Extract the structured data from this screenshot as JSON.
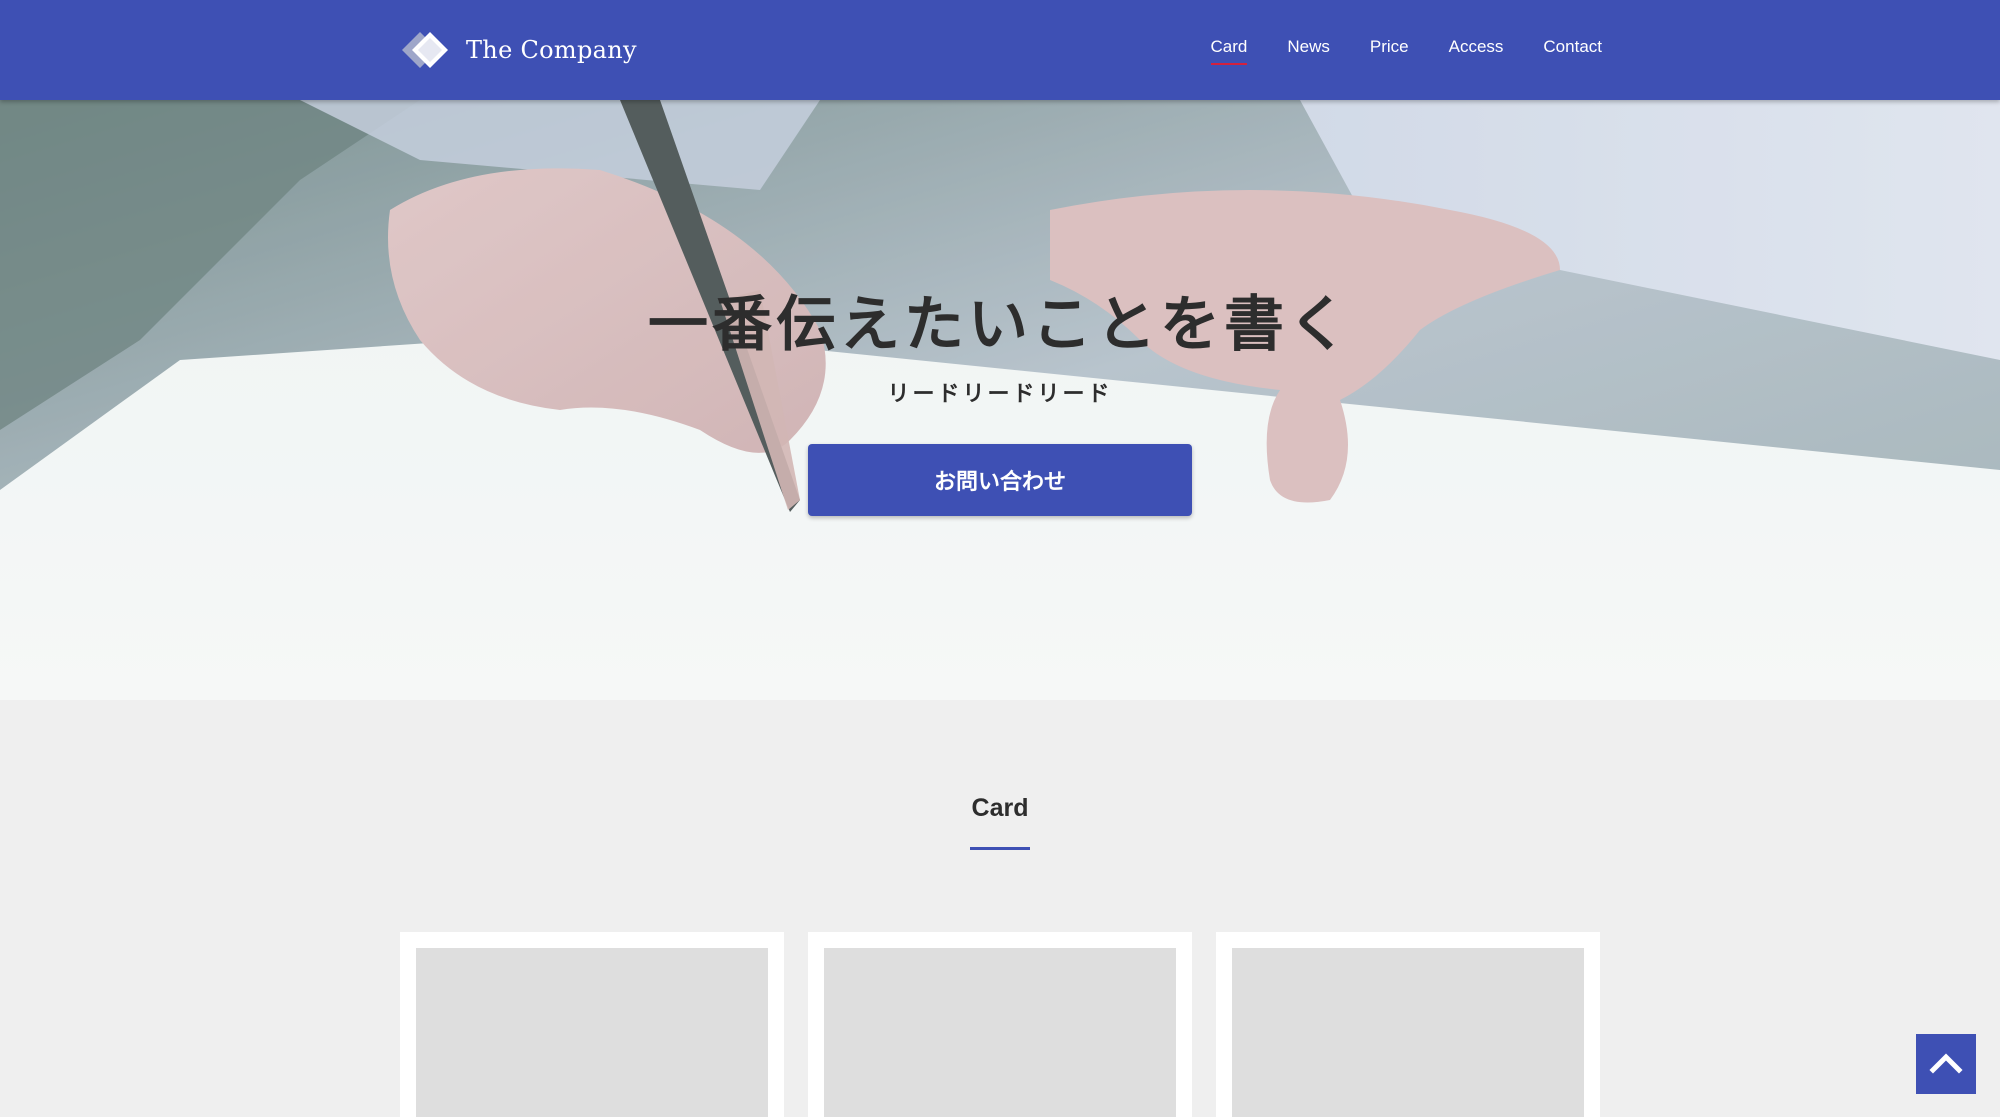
{
  "header": {
    "logo_text": "The Company",
    "nav": [
      {
        "label": "Card",
        "active": true
      },
      {
        "label": "News",
        "active": false
      },
      {
        "label": "Price",
        "active": false
      },
      {
        "label": "Access",
        "active": false
      },
      {
        "label": "Contact",
        "active": false
      }
    ]
  },
  "hero": {
    "title": "一番伝えたいことを書く",
    "lead": "リードリードリード",
    "button_label": "お問い合わせ",
    "image": "writing-hand-with-pen"
  },
  "card_section": {
    "title": "Card",
    "cards": [
      {
        "image": "placeholder"
      },
      {
        "image": "placeholder"
      },
      {
        "image": "placeholder"
      }
    ]
  },
  "back_to_top": {
    "icon": "chevron-up-icon"
  },
  "colors": {
    "primary": "#3e50b4",
    "nav_active_underline": "#d3213d",
    "background": "#efefef",
    "text": "#2d2d2d",
    "card_placeholder": "#dedede"
  }
}
